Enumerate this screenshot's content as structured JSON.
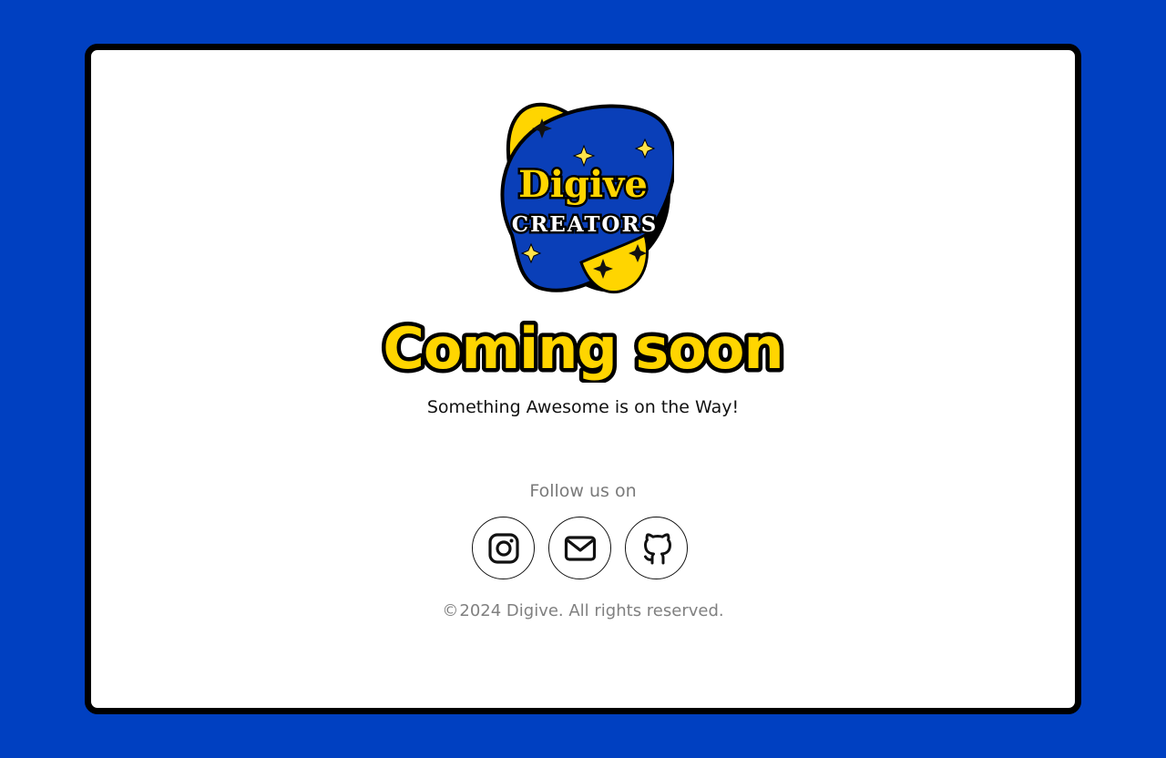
{
  "colors": {
    "page_background": "#0040C1",
    "card_background": "#FFFFFF",
    "card_border": "#000000",
    "brand_yellow": "#FFD500",
    "brand_blue": "#0A3FB8",
    "muted_text": "#808080"
  },
  "logo": {
    "line1": "Digive",
    "line2": "CREATORS"
  },
  "hero": {
    "headline": "Coming soon",
    "tagline": "Something Awesome is on the Way!"
  },
  "social": {
    "label": "Follow us on",
    "links": [
      {
        "name": "Instagram",
        "icon": "instagram-icon"
      },
      {
        "name": "Email",
        "icon": "mail-icon"
      },
      {
        "name": "GitHub",
        "icon": "github-icon"
      }
    ]
  },
  "footer": {
    "copyright_symbol": "©",
    "copyright": "2024 Digive. All rights reserved."
  }
}
